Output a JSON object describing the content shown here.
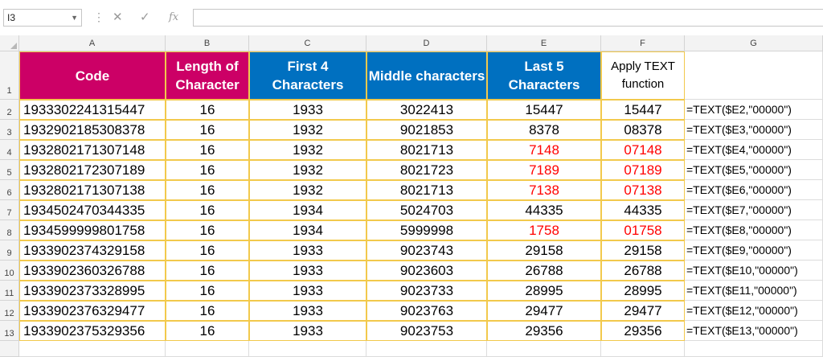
{
  "name_box": "I3",
  "formula_bar": {
    "value": ""
  },
  "columns": [
    "A",
    "B",
    "C",
    "D",
    "E",
    "F",
    "G"
  ],
  "header_row": {
    "row_num": "1",
    "code": "Code",
    "length": "Length of Character",
    "first4": "First 4 Characters",
    "middle": "Middle characters",
    "last5": "Last 5 Characters",
    "apply": "Apply TEXT function"
  },
  "rows": [
    {
      "n": "2",
      "code": "1933302241315447",
      "len": "16",
      "first": "1933",
      "mid": "3022413",
      "last": "15447",
      "text": "15447",
      "formula": "=TEXT($E2,\"00000\")",
      "red": false
    },
    {
      "n": "3",
      "code": "1932902185308378",
      "len": "16",
      "first": "1932",
      "mid": "9021853",
      "last": "8378",
      "text": "08378",
      "formula": "=TEXT($E3,\"00000\")",
      "red": false
    },
    {
      "n": "4",
      "code": "1932802171307148",
      "len": "16",
      "first": "1932",
      "mid": "8021713",
      "last": "7148",
      "text": "07148",
      "formula": "=TEXT($E4,\"00000\")",
      "red": true
    },
    {
      "n": "5",
      "code": "1932802172307189",
      "len": "16",
      "first": "1932",
      "mid": "8021723",
      "last": "7189",
      "text": "07189",
      "formula": "=TEXT($E5,\"00000\")",
      "red": true
    },
    {
      "n": "6",
      "code": "1932802171307138",
      "len": "16",
      "first": "1932",
      "mid": "8021713",
      "last": "7138",
      "text": "07138",
      "formula": "=TEXT($E6,\"00000\")",
      "red": true
    },
    {
      "n": "7",
      "code": "1934502470344335",
      "len": "16",
      "first": "1934",
      "mid": "5024703",
      "last": "44335",
      "text": "44335",
      "formula": "=TEXT($E7,\"00000\")",
      "red": false
    },
    {
      "n": "8",
      "code": "1934599999801758",
      "len": "16",
      "first": "1934",
      "mid": "5999998",
      "last": "1758",
      "text": "01758",
      "formula": "=TEXT($E8,\"00000\")",
      "red": true
    },
    {
      "n": "9",
      "code": "1933902374329158",
      "len": "16",
      "first": "1933",
      "mid": "9023743",
      "last": "29158",
      "text": "29158",
      "formula": "=TEXT($E9,\"00000\")",
      "red": false
    },
    {
      "n": "10",
      "code": "1933902360326788",
      "len": "16",
      "first": "1933",
      "mid": "9023603",
      "last": "26788",
      "text": "26788",
      "formula": "=TEXT($E10,\"00000\")",
      "red": false
    },
    {
      "n": "11",
      "code": "1933902373328995",
      "len": "16",
      "first": "1933",
      "mid": "9023733",
      "last": "28995",
      "text": "28995",
      "formula": "=TEXT($E11,\"00000\")",
      "red": false
    },
    {
      "n": "12",
      "code": "1933902376329477",
      "len": "16",
      "first": "1933",
      "mid": "9023763",
      "last": "29477",
      "text": "29477",
      "formula": "=TEXT($E12,\"00000\")",
      "red": false
    },
    {
      "n": "13",
      "code": "1933902375329356",
      "len": "16",
      "first": "1933",
      "mid": "9023753",
      "last": "29356",
      "text": "29356",
      "formula": "=TEXT($E13,\"00000\")",
      "red": false
    }
  ],
  "colors": {
    "pink": "#cc0066",
    "blue": "#0070c0",
    "red": "#ff0000",
    "yellow_border": "#f2c94c"
  }
}
